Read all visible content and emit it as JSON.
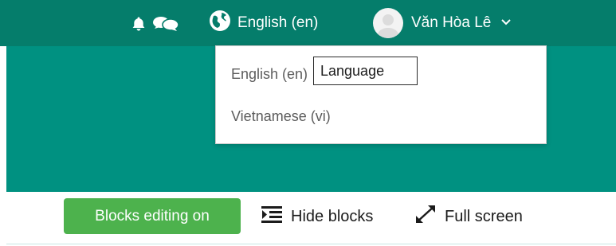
{
  "navbar": {
    "icons": [
      "bell-icon",
      "chat-icon",
      "globe-icon",
      "chevron-down-icon"
    ],
    "language_label": "English (en)",
    "user_name": "Văn Hòa Lê",
    "colors": {
      "bar": "#057d6b",
      "hero": "#009181"
    }
  },
  "language_dropdown": {
    "items": [
      "English (en)",
      "Vietnamese (vi)"
    ],
    "tooltip": "Language"
  },
  "toolbar": {
    "blocks_editing_label": "Blocks editing on",
    "hide_blocks_label": "Hide blocks",
    "full_screen_label": "Full screen",
    "colors": {
      "blocks_editing_bg": "#4db24d"
    }
  }
}
